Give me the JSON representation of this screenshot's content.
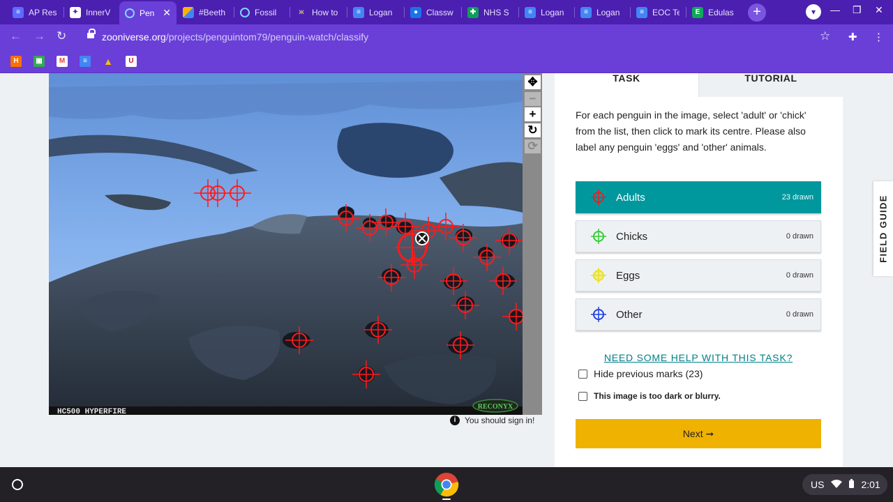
{
  "browser": {
    "tabs": [
      {
        "title": "AP Res",
        "icon": "list-icon",
        "color": "#5b6cff"
      },
      {
        "title": "InnerV",
        "icon": "puzzle-icon",
        "color": "#ffffff"
      },
      {
        "title": "Pen",
        "icon": "zooniverse-icon",
        "color": "#00979d",
        "close": "✕"
      },
      {
        "title": "#Beeth",
        "icon": "blocks-icon",
        "color": "#ffb300"
      },
      {
        "title": "Fossil",
        "icon": "zooniverse-icon",
        "color": "#00979d"
      },
      {
        "title": "How to",
        "icon": "butterfly-icon",
        "color": "#8c7a3a"
      },
      {
        "title": "Logan",
        "icon": "docs-icon",
        "color": "#4285f4"
      },
      {
        "title": "Classw",
        "icon": "classroom-icon",
        "color": "#1a73e8"
      },
      {
        "title": "NHS S",
        "icon": "cross-icon",
        "color": "#0f9d58"
      },
      {
        "title": "Logan",
        "icon": "docs-icon",
        "color": "#4285f4"
      },
      {
        "title": "Logan",
        "icon": "docs-icon",
        "color": "#4285f4"
      },
      {
        "title": "EOC Te",
        "icon": "docs-icon",
        "color": "#4285f4"
      },
      {
        "title": "Edulas",
        "icon": "edulastic-icon",
        "color": "#0fa958"
      }
    ],
    "new_tab": "+",
    "url_host": "zooniverse.org",
    "url_path": "/projects/penguintom79/penguin-watch/classify",
    "nav_back": "←",
    "nav_forward": "→",
    "nav_reload": "↻",
    "star": "☆",
    "extensions": "✚",
    "menu": "⋮",
    "window_minimize": "—",
    "window_restore": "❐",
    "window_close": "✕",
    "profile_glyph": "▾"
  },
  "bookmarks": [
    {
      "icon": "home-bookmark-icon",
      "color": "#ff6f00",
      "glyph": "H"
    },
    {
      "icon": "photo-bookmark-icon",
      "color": "#34a853",
      "glyph": "▣"
    },
    {
      "icon": "gmail-bookmark-icon",
      "color": "#ea4335",
      "glyph": "M"
    },
    {
      "icon": "docs-bookmark-icon",
      "color": "#4285f4",
      "glyph": "≡"
    },
    {
      "icon": "drive-bookmark-icon",
      "color": "#fbbc04",
      "glyph": "▲"
    },
    {
      "icon": "school-bookmark-icon",
      "color": "#ffffff",
      "glyph": "U"
    }
  ],
  "viewer": {
    "camera_text": "HC500  HYPERFIRE",
    "brand_text": "RECONYX",
    "controls": [
      {
        "name": "pan-control",
        "glyph": "✥",
        "disabled": false
      },
      {
        "name": "zoom-out-control",
        "glyph": "−",
        "disabled": true
      },
      {
        "name": "zoom-in-control",
        "glyph": "+",
        "disabled": false
      },
      {
        "name": "rotate-control",
        "glyph": "↻",
        "disabled": false
      },
      {
        "name": "reset-control",
        "glyph": "⟳",
        "disabled": true
      }
    ],
    "signin_notice": "You should sign in!",
    "mark_color": "#ff1a1a"
  },
  "task": {
    "tab_task": "TASK",
    "tab_tutorial": "TUTORIAL",
    "instructions": "For each penguin in the image, select 'adult' or 'chick' from the list, then click to mark its centre. Please also label any penguin 'eggs' and 'other' animals.",
    "tools": [
      {
        "label": "Adults",
        "count": "23 drawn",
        "color": "#e82020",
        "active": true
      },
      {
        "label": "Chicks",
        "count": "0 drawn",
        "color": "#33cc33",
        "active": false
      },
      {
        "label": "Eggs",
        "count": "0 drawn",
        "color": "#e8e020",
        "active": false
      },
      {
        "label": "Other",
        "count": "0 drawn",
        "color": "#2040e0",
        "active": false
      }
    ],
    "help_link": "NEED SOME HELP WITH THIS TASK?",
    "hide_marks_label": "Hide previous marks (23)",
    "too_dark_label": "This image is too dark or blurry.",
    "next_label": "Next ➞",
    "field_guide": "FIELD GUIDE",
    "accent_teal": "#00979d",
    "next_color": "#f0b200"
  },
  "shelf": {
    "locale": "US",
    "time": "2:01"
  }
}
